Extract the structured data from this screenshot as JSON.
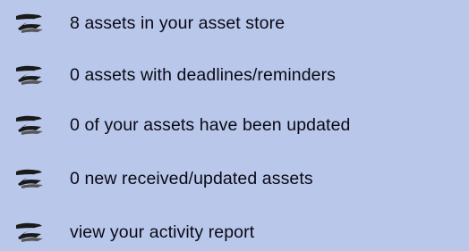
{
  "summary": {
    "items": [
      {
        "label": "8 assets in your asset store",
        "icon": "z-bullet-icon"
      },
      {
        "label": "0 assets with deadlines/reminders",
        "icon": "z-bullet-icon"
      },
      {
        "label": "0 of your assets have been updated",
        "icon": "z-bullet-icon"
      },
      {
        "label": "0 new received/updated assets",
        "icon": "z-bullet-icon"
      },
      {
        "label": "view your activity report",
        "icon": "z-bullet-icon"
      }
    ]
  },
  "colors": {
    "background": "#b9c7eb",
    "text": "#0a0a14",
    "icon": "#1a1a1a"
  }
}
